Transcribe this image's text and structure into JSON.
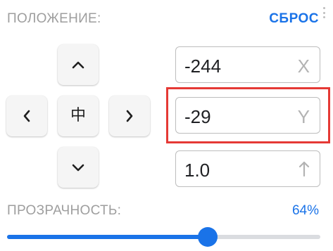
{
  "position_section": {
    "title": "ПОЛОЖЕНИЕ:",
    "reset_label": "СБРОС"
  },
  "dpad": {
    "up_icon": "chevron-up-icon",
    "down_icon": "chevron-down-icon",
    "left_icon": "chevron-left-icon",
    "right_icon": "chevron-right-icon",
    "center_glyph": "中"
  },
  "fields": {
    "x": {
      "value": "-244",
      "suffix": "X"
    },
    "y": {
      "value": "-29",
      "suffix": "Y"
    },
    "z": {
      "value": "1.0",
      "icon": "arrow-up-icon"
    }
  },
  "opacity_section": {
    "label": "ПРОЗРАЧНОСТЬ:",
    "value_text": "64%",
    "value": 0.64
  },
  "colors": {
    "accent": "#1a73e8",
    "highlight": "#e53935",
    "muted_label": "#9e9e9e"
  }
}
